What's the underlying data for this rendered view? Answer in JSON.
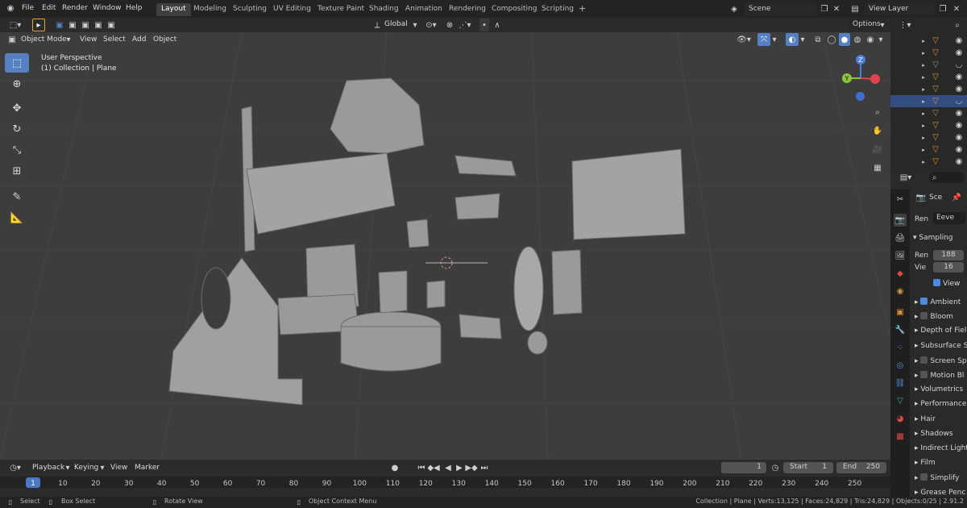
{
  "topbar": {
    "menus": [
      "File",
      "Edit",
      "Render",
      "Window",
      "Help"
    ],
    "workspaces": [
      "Layout",
      "Modeling",
      "Sculpting",
      "UV Editing",
      "Texture Paint",
      "Shading",
      "Animation",
      "Rendering",
      "Compositing",
      "Scripting"
    ],
    "active_workspace": "Layout",
    "add_tab": "+",
    "scene": "Scene",
    "view_layer": "View Layer"
  },
  "viewport_header": {
    "mode": "Object Mode",
    "menus": [
      "View",
      "Select",
      "Add",
      "Object"
    ],
    "orientation": "Global",
    "options": "Options"
  },
  "viewport": {
    "perspective": "User Perspective",
    "collection": "(1) Collection | Plane",
    "gizmo": {
      "x": "X",
      "y": "Y",
      "z": "Z"
    },
    "colors": {
      "x_axis": "#e2424d",
      "y_axis": "#8cc63a",
      "z_axis": "#4a7fe0",
      "background": "#3d3d3d",
      "accent": "#5680c2"
    }
  },
  "properties": {
    "scene_label": "Sce",
    "render_engine_label": "Ren",
    "render_engine": "Eeve",
    "sampling": "Sampling",
    "render_samples_label": "Ren",
    "render_samples": "188",
    "viewport_samples_label": "Vie",
    "viewport_samples": "16",
    "viewport_denoise": "View",
    "panels": [
      {
        "label": "Ambient",
        "check": true
      },
      {
        "label": "Bloom",
        "check": false
      },
      {
        "label": "Depth of Fiel",
        "check": null
      },
      {
        "label": "Subsurface S",
        "check": null
      },
      {
        "label": "Screen Sp",
        "check": false
      },
      {
        "label": "Motion Bl",
        "check": false
      },
      {
        "label": "Volumetrics",
        "check": null
      },
      {
        "label": "Performance",
        "check": null
      },
      {
        "label": "Hair",
        "check": null
      },
      {
        "label": "Shadows",
        "check": null
      },
      {
        "label": "Indirect Light",
        "check": null
      },
      {
        "label": "Film",
        "check": null
      },
      {
        "label": "Simplify",
        "check": false
      },
      {
        "label": "Grease Penc",
        "check": null
      }
    ]
  },
  "timeline": {
    "menus": [
      "Playback",
      "Keying",
      "View",
      "Marker"
    ],
    "current_frame": "1",
    "start_label": "Start",
    "start": "1",
    "end_label": "End",
    "end": "250",
    "ticks": [
      "1",
      "10",
      "20",
      "30",
      "40",
      "50",
      "60",
      "70",
      "80",
      "90",
      "100",
      "110",
      "120",
      "130",
      "140",
      "150",
      "160",
      "170",
      "180",
      "190",
      "200",
      "210",
      "220",
      "230",
      "240",
      "250"
    ]
  },
  "status": {
    "select": "Select",
    "box_select": "Box Select",
    "rotate_view": "Rotate View",
    "context_menu": "Object Context Menu",
    "stats": "Collection | Plane | Verts:13,125 | Faces:24,829 | Tris:24,829 | Objects:0/25 | 2.91.2"
  }
}
